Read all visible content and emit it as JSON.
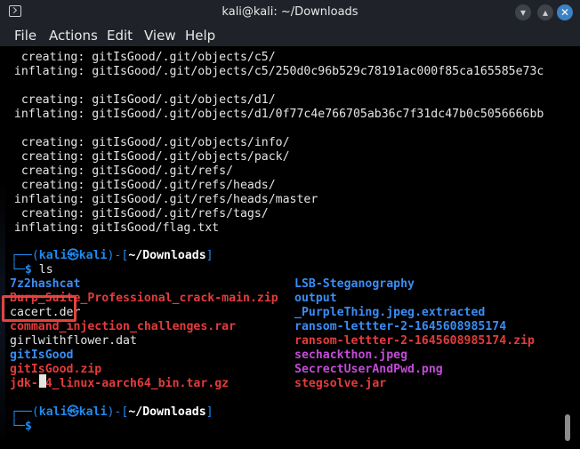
{
  "window": {
    "title": "kali@kali: ~/Downloads",
    "buttons": {
      "minimize": "▾",
      "maximize": "▴",
      "close": "✕"
    }
  },
  "menu": [
    "File",
    "Actions",
    "Edit",
    "View",
    "Help"
  ],
  "output_lines": [
    "   creating: gitIsGood/.git/objects/c5/",
    "  inflating: gitIsGood/.git/objects/c5/250d0c96b529c78191ac000f85ca165585e73c",
    "",
    "   creating: gitIsGood/.git/objects/d1/",
    "  inflating: gitIsGood/.git/objects/d1/0f77c4e766705ab36c7f31dc47b0c5056666bb",
    "",
    "   creating: gitIsGood/.git/objects/info/",
    "   creating: gitIsGood/.git/objects/pack/",
    "   creating: gitIsGood/.git/refs/",
    "   creating: gitIsGood/.git/refs/heads/",
    "  inflating: gitIsGood/.git/refs/heads/master",
    "   creating: gitIsGood/.git/refs/tags/",
    "  inflating: gitIsGood/flag.txt"
  ],
  "prompt": {
    "open": "┌──(",
    "user": "kali㉿kali",
    "close": ")-[",
    "dir": "~/Downloads",
    "end": "]",
    "second": "└─",
    "dollar": "$"
  },
  "command": " ls",
  "listing_left": [
    {
      "name": "7z2hashcat",
      "color": "blue"
    },
    {
      "name": "Burp_Suite_Professional_crack-main.zip",
      "color": "red"
    },
    {
      "name": "cacert.der",
      "color": "white"
    },
    {
      "name": "command_injection_challenges.rar",
      "color": "red"
    },
    {
      "name": "girlwithflower.dat",
      "color": "white"
    },
    {
      "name": "gitIsGood",
      "color": "blue"
    },
    {
      "name": "gitIsGood.zip",
      "color": "red"
    },
    {
      "name": "jdk-24_linux-aarch64_bin.tar.gz",
      "color": "red"
    }
  ],
  "listing_right": [
    {
      "name": "LSB-Steganography",
      "color": "blue"
    },
    {
      "name": "output",
      "color": "blue"
    },
    {
      "name": "_PurpleThing.jpeg.extracted",
      "color": "blue"
    },
    {
      "name": "ransom-lettter-2-1645608985174",
      "color": "blue"
    },
    {
      "name": "ransom-lettter-2-1645608985174.zip",
      "color": "red"
    },
    {
      "name": "sechackthon.jpeg",
      "color": "purple"
    },
    {
      "name": "SecrectUserAndPwd.png",
      "color": "purple"
    },
    {
      "name": "stegsolve.jar",
      "color": "red"
    }
  ],
  "colors": {
    "titlebar": "#1f2229",
    "prompt_blue": "#1e8bf0",
    "dir_blue": "#3a8df5",
    "archive_red": "#e43b3b",
    "image_purple": "#c34bd8",
    "highlight": "#e2443d"
  },
  "icons": {
    "app": "terminal-icon",
    "minimize": "chevron-down-icon",
    "maximize": "chevron-up-icon",
    "close": "close-icon"
  }
}
